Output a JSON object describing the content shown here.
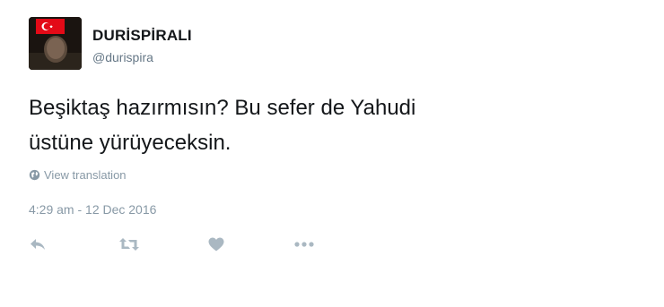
{
  "tweet": {
    "display_name": "DURİSPİRALI",
    "handle": "@durispira",
    "text_line1": "Beşiktaş hazırmısın? Bu sefer de Yahudi",
    "text_line2": "üstüne yürüyeceksin.",
    "translate_label": "View translation",
    "timestamp": "4:29 am - 12 Dec 2016"
  },
  "icons": {
    "avatar": "profile-photo",
    "translate": "globe-icon",
    "reply": "reply-icon",
    "retweet": "retweet-icon",
    "like": "heart-icon",
    "more": "more-dots-icon"
  },
  "colors": {
    "text": "#14171a",
    "secondary": "#657786",
    "muted": "#8899a6",
    "action_icon": "#aab8c2",
    "flag_red": "#e30a17"
  }
}
